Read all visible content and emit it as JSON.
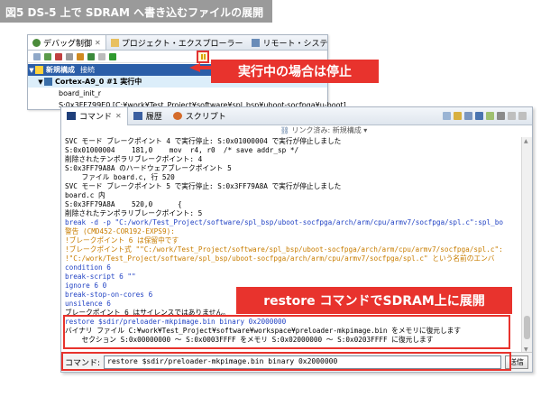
{
  "figure_title": "図5 DS-5 上で SDRAM へ書き込むファイルの展開",
  "debug_panel": {
    "tabs": [
      {
        "label": "デバッグ制御",
        "close": "✕"
      },
      {
        "label": "プロジェクト・エクスプローラー"
      },
      {
        "label": "リモート・システム"
      }
    ],
    "tree": [
      {
        "label": "新規構成",
        "status": "接続"
      },
      {
        "label": "Cortex-A9_0 #1 実行中"
      },
      {
        "label": "board_init_r"
      },
      {
        "label": "S:0x3FF799E0 [C:¥work¥Test_Project¥software¥spl_bsp¥uboot-socfpga¥u-boot]"
      }
    ]
  },
  "callouts": {
    "stop": "実行中の場合は停止",
    "restore": "restore コマンドでSDRAM上に展開"
  },
  "command_panel": {
    "tabs": [
      {
        "label": "コマンド",
        "close": "✕"
      },
      {
        "label": "履歴"
      },
      {
        "label": "スクリプト"
      }
    ],
    "link_line": "リンク済み: 新規構成 ▾",
    "log": [
      {
        "text": "SVC モード ブレークポイント 4 で実行停止: S:0x01000004 で実行が停止しました",
        "color": "black"
      },
      {
        "text": "S:0x01000004    181,0    mov  r4, r0  /* save addr_sp */",
        "color": "black"
      },
      {
        "text": "削除されたテンポラリブレークポイント: 4",
        "color": "black"
      },
      {
        "text": "S:0x3FF79A8A のハードウェアブレークポイント 5",
        "color": "black"
      },
      {
        "text": "    ファイル board.c, 行 520",
        "color": "black"
      },
      {
        "text": "SVC モード ブレークポイント 5 で実行停止: S:0x3FF79A8A で実行が停止しました",
        "color": "black"
      },
      {
        "text": "board.c 内",
        "color": "black"
      },
      {
        "text": "S:0x3FF79A8A    520,0      {",
        "color": "black"
      },
      {
        "text": "削除されたテンポラリブレークポイント: 5",
        "color": "black"
      },
      {
        "text": "break -d -p \"C:/work/Test_Project/software/spl_bsp/uboot-socfpga/arch/arm/cpu/armv7/socfpga/spl.c\":spl_bo",
        "color": "blue"
      },
      {
        "text": "警告 (CMD452-COR192-EXPS9):",
        "color": "orange"
      },
      {
        "text": "!ブレークポイント 6 は保留中です",
        "color": "orange"
      },
      {
        "text": "!ブレークポイント式 \"\"C:/work/Test_Project/software/spl_bsp/uboot-socfpga/arch/arm/cpu/armv7/socfpga/spl.c\":",
        "color": "orange"
      },
      {
        "text": "!\"C:/work/Test_Project/software/spl_bsp/uboot-socfpga/arch/arm/cpu/armv7/socfpga/spl.c\" という名前のエンバ",
        "color": "orange"
      },
      {
        "text": "condition 6",
        "color": "blue"
      },
      {
        "text": "break-script 6 \"\"",
        "color": "blue"
      },
      {
        "text": "ignore 6 0",
        "color": "blue"
      },
      {
        "text": "break-stop-on-cores 6",
        "color": "blue"
      },
      {
        "text": "unsilence 6",
        "color": "blue"
      },
      {
        "text": "ブレークポイント 6 はサイレンスではありません。",
        "color": "black"
      },
      {
        "text": "restore $sdir/preloader-mkpimage.bin binary 0x2000000",
        "color": "blue"
      },
      {
        "text": "バイナリ ファイル C:¥work¥Test_Project¥software¥workspace¥preloader-mkpimage.bin をメモリに復元します",
        "color": "black"
      },
      {
        "text": "    セクション S:0x00000000 ～ S:0x0003FFFF をメモリ S:0x02000000 ～ S:0x0203FFFF に復元します",
        "color": "black"
      }
    ],
    "command_label": "コマンド:",
    "command_value": "restore $sdir/preloader-mkpimage.bin binary 0x2000000",
    "send_label": "送信"
  }
}
